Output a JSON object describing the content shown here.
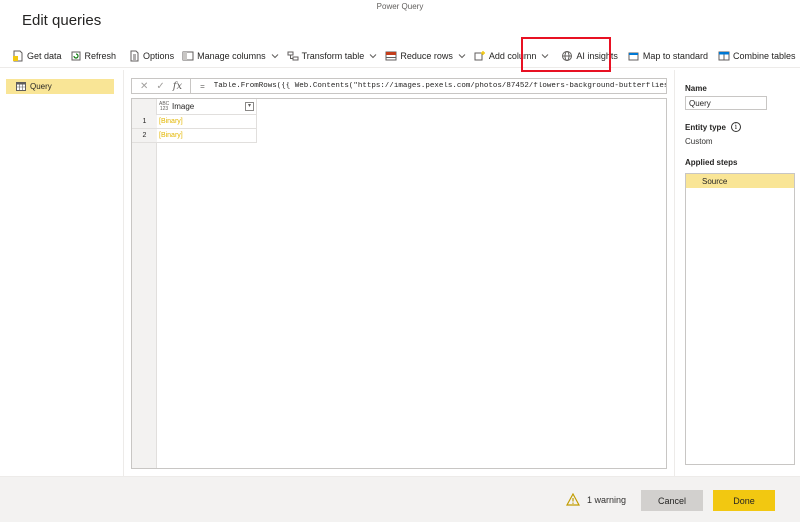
{
  "window": {
    "app_title": "Power Query",
    "dialog_title": "Edit queries"
  },
  "toolbar": {
    "get_data": "Get data",
    "refresh": "Refresh",
    "options": "Options",
    "manage_columns": "Manage columns",
    "transform_table": "Transform table",
    "reduce_rows": "Reduce rows",
    "add_column": "Add column",
    "ai_insights": "AI insights",
    "map_to_standard": "Map to standard",
    "combine_tables": "Combine tables"
  },
  "queries": {
    "items": [
      {
        "label": "Query"
      }
    ]
  },
  "formula_bar": {
    "fx": "fx",
    "equals": "=",
    "formula": "Table.FromRows({{ Web.Contents(\"https://images.pexels.com/photos/87452/flowers-background-butterflies-beaut"
  },
  "grid": {
    "type_top": "ABC",
    "type_bottom": "123",
    "column_header": "Image",
    "rows": [
      {
        "num": "1",
        "value": "[Binary]"
      },
      {
        "num": "2",
        "value": "[Binary]"
      }
    ]
  },
  "properties": {
    "name_label": "Name",
    "name_value": "Query",
    "entity_type_label": "Entity type",
    "entity_type_value": "Custom",
    "applied_steps_label": "Applied steps",
    "steps": [
      {
        "label": "Source"
      }
    ]
  },
  "footer": {
    "warning": "1 warning",
    "cancel": "Cancel",
    "done": "Done"
  },
  "colors": {
    "accent_yellow": "#f2c811",
    "selection_yellow": "#f9e596",
    "highlight_red": "#e81123",
    "binary_text": "#e3b600"
  }
}
